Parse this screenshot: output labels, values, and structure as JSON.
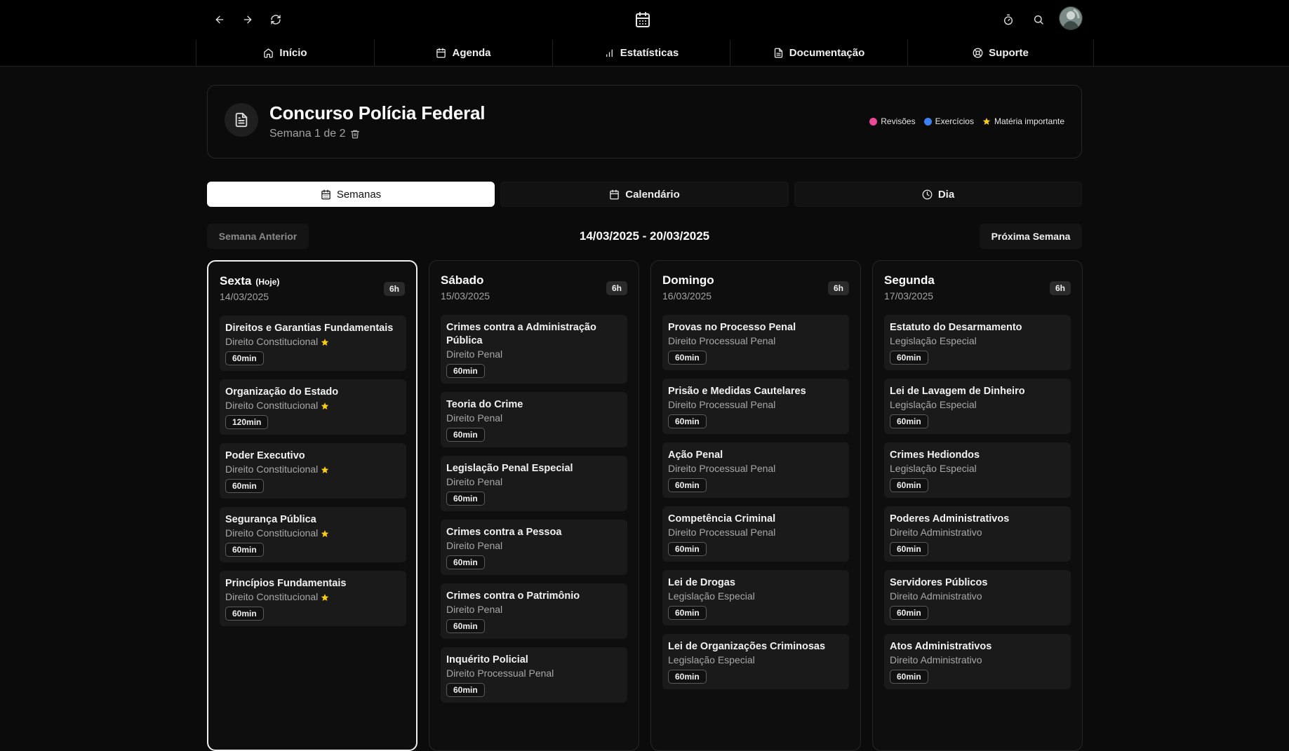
{
  "topbar": {
    "back_icon": "arrow-left-icon",
    "forward_icon": "arrow-right-icon",
    "refresh_icon": "refresh-icon",
    "center_icon": "calendar-icon",
    "timer_icon": "timer-icon",
    "search_icon": "search-icon"
  },
  "nav": {
    "items": [
      {
        "label": "Início",
        "icon": "home-icon"
      },
      {
        "label": "Agenda",
        "icon": "calendar-icon"
      },
      {
        "label": "Estatísticas",
        "icon": "bar-chart-icon"
      },
      {
        "label": "Documentação",
        "icon": "file-text-icon"
      },
      {
        "label": "Suporte",
        "icon": "lifebuoy-icon"
      }
    ]
  },
  "header": {
    "title": "Concurso Polícia Federal",
    "subtitle": "Semana 1 de 2",
    "legend": [
      {
        "label": "Revisões",
        "color": "#ec4899"
      },
      {
        "label": "Exercícios",
        "color": "#3b82f6"
      },
      {
        "label": "Matéria importante",
        "color": "#facc15"
      }
    ]
  },
  "tabs": [
    {
      "label": "Semanas",
      "active": true
    },
    {
      "label": "Calendário",
      "active": false
    },
    {
      "label": "Dia",
      "active": false
    }
  ],
  "week": {
    "prev_label": "Semana Anterior",
    "range": "14/03/2025 - 20/03/2025",
    "next_label": "Próxima Semana"
  },
  "days": [
    {
      "name": "Sexta",
      "today_label": "(Hoje)",
      "date": "14/03/2025",
      "hours": "6h",
      "sessions": [
        {
          "title": "Direitos e Garantias Fundamentais",
          "subject": "Direito Constitucional",
          "important": true,
          "duration": "60min"
        },
        {
          "title": "Organização do Estado",
          "subject": "Direito Constitucional",
          "important": true,
          "duration": "120min"
        },
        {
          "title": "Poder Executivo",
          "subject": "Direito Constitucional",
          "important": true,
          "duration": "60min"
        },
        {
          "title": "Segurança Pública",
          "subject": "Direito Constitucional",
          "important": true,
          "duration": "60min"
        },
        {
          "title": "Princípios Fundamentais",
          "subject": "Direito Constitucional",
          "important": true,
          "duration": "60min"
        }
      ]
    },
    {
      "name": "Sábado",
      "today_label": "",
      "date": "15/03/2025",
      "hours": "6h",
      "sessions": [
        {
          "title": "Crimes contra a Administração Pública",
          "subject": "Direito Penal",
          "important": false,
          "duration": "60min"
        },
        {
          "title": "Teoria do Crime",
          "subject": "Direito Penal",
          "important": false,
          "duration": "60min"
        },
        {
          "title": "Legislação Penal Especial",
          "subject": "Direito Penal",
          "important": false,
          "duration": "60min"
        },
        {
          "title": "Crimes contra a Pessoa",
          "subject": "Direito Penal",
          "important": false,
          "duration": "60min"
        },
        {
          "title": "Crimes contra o Patrimônio",
          "subject": "Direito Penal",
          "important": false,
          "duration": "60min"
        },
        {
          "title": "Inquérito Policial",
          "subject": "Direito Processual Penal",
          "important": false,
          "duration": "60min"
        }
      ]
    },
    {
      "name": "Domingo",
      "today_label": "",
      "date": "16/03/2025",
      "hours": "6h",
      "sessions": [
        {
          "title": "Provas no Processo Penal",
          "subject": "Direito Processual Penal",
          "important": false,
          "duration": "60min"
        },
        {
          "title": "Prisão e Medidas Cautelares",
          "subject": "Direito Processual Penal",
          "important": false,
          "duration": "60min"
        },
        {
          "title": "Ação Penal",
          "subject": "Direito Processual Penal",
          "important": false,
          "duration": "60min"
        },
        {
          "title": "Competência Criminal",
          "subject": "Direito Processual Penal",
          "important": false,
          "duration": "60min"
        },
        {
          "title": "Lei de Drogas",
          "subject": "Legislação Especial",
          "important": false,
          "duration": "60min"
        },
        {
          "title": "Lei de Organizações Criminosas",
          "subject": "Legislação Especial",
          "important": false,
          "duration": "60min"
        }
      ]
    },
    {
      "name": "Segunda",
      "today_label": "",
      "date": "17/03/2025",
      "hours": "6h",
      "sessions": [
        {
          "title": "Estatuto do Desarmamento",
          "subject": "Legislação Especial",
          "important": false,
          "duration": "60min"
        },
        {
          "title": "Lei de Lavagem de Dinheiro",
          "subject": "Legislação Especial",
          "important": false,
          "duration": "60min"
        },
        {
          "title": "Crimes Hediondos",
          "subject": "Legislação Especial",
          "important": false,
          "duration": "60min"
        },
        {
          "title": "Poderes Administrativos",
          "subject": "Direito Administrativo",
          "important": false,
          "duration": "60min"
        },
        {
          "title": "Servidores Públicos",
          "subject": "Direito Administrativo",
          "important": false,
          "duration": "60min"
        },
        {
          "title": "Atos Administrativos",
          "subject": "Direito Administrativo",
          "important": false,
          "duration": "60min"
        }
      ]
    }
  ]
}
